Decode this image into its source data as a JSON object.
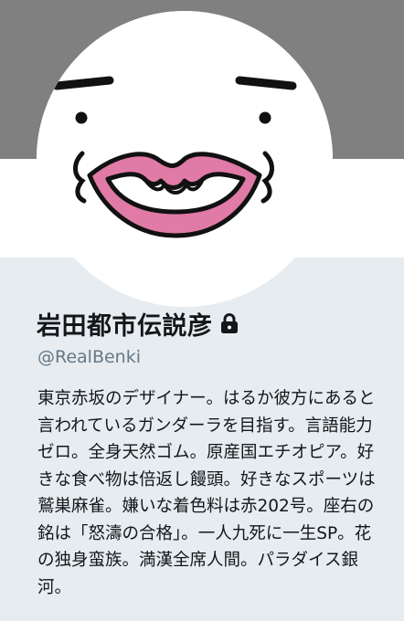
{
  "profile": {
    "display_name": "岩田都市伝説彦",
    "handle": "@RealBenki",
    "bio": "東京赤坂のデザイナー。はるか彼方にあると言われているガンダーラを目指す。言語能力ゼロ。全身天然ゴム。原産国エチオピア。好きな食べ物は倍返し饅頭。好きなスポーツは鷲巣麻雀。嫌いな着色料は赤202号。座右の銘は「怒濤の合格」。一人九死に一生SP。花の独身蛮族。満漢全席人間。パラダイス銀河。"
  },
  "icons": {
    "lock": "lock-icon",
    "avatar": "avatar-face-with-pink-lips"
  },
  "colors": {
    "banner": "#808080",
    "page_bg": "#e6ecf0",
    "lip_pink": "#e07aa6",
    "text_primary": "#14171a",
    "text_secondary": "#657786"
  }
}
